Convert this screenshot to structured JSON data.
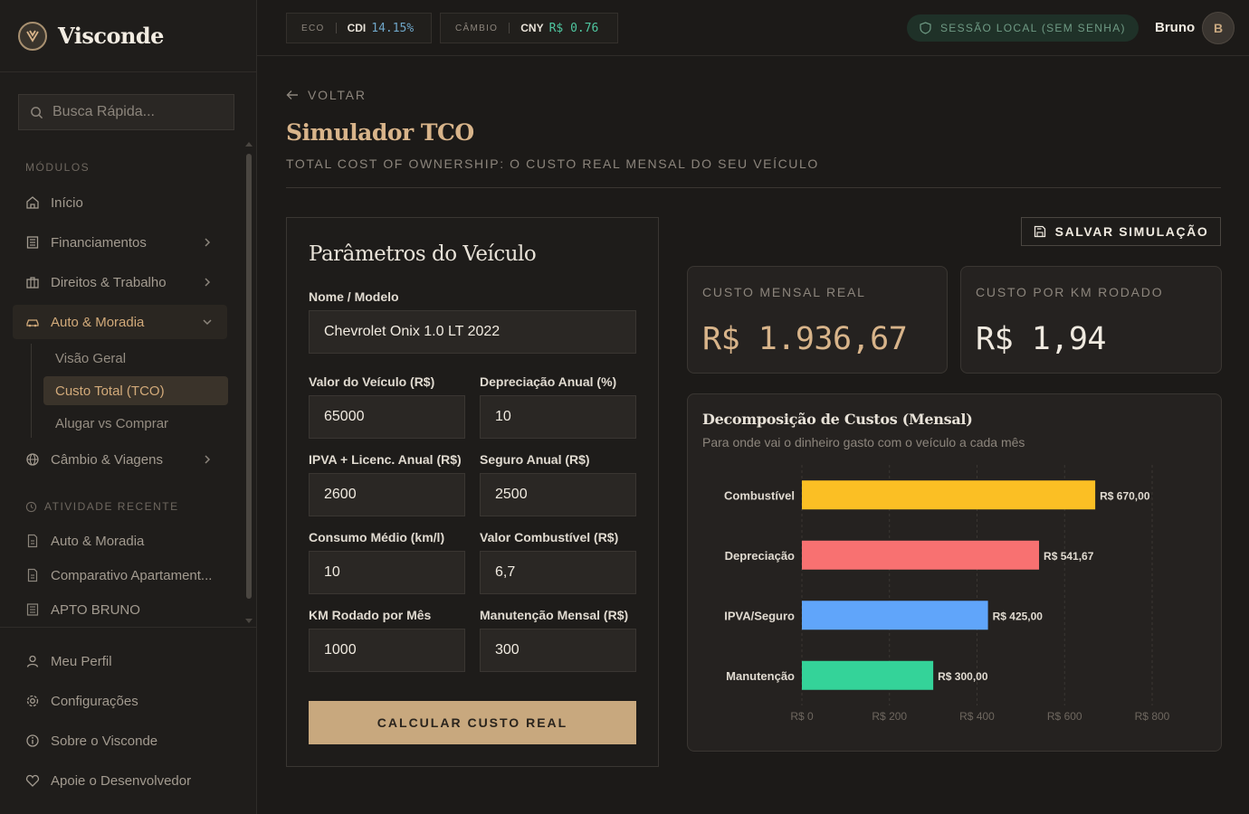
{
  "app": {
    "name": "Visconde"
  },
  "search": {
    "placeholder": "Busca Rápida..."
  },
  "sidebar": {
    "modules_label": "MÓDULOS",
    "items": [
      {
        "label": "Início",
        "icon": "home-icon"
      },
      {
        "label": "Financiamentos",
        "icon": "building-icon"
      },
      {
        "label": "Direitos & Trabalho",
        "icon": "briefcase-icon"
      },
      {
        "label": "Auto & Moradia",
        "icon": "car-icon"
      },
      {
        "label": "Câmbio & Viagens",
        "icon": "globe-icon"
      }
    ],
    "sub_items": [
      {
        "label": "Visão Geral"
      },
      {
        "label": "Custo Total (TCO)"
      },
      {
        "label": "Alugar vs Comprar"
      }
    ],
    "recent_label": "ATIVIDADE RECENTE",
    "recent": [
      {
        "label": "Auto & Moradia"
      },
      {
        "label": "Comparativo Apartament..."
      },
      {
        "label": "APTO BRUNO"
      }
    ],
    "footer": [
      {
        "label": "Meu Perfil",
        "icon": "user-icon"
      },
      {
        "label": "Configurações",
        "icon": "gear-icon"
      },
      {
        "label": "Sobre o Visconde",
        "icon": "info-icon"
      },
      {
        "label": "Apoie o Desenvolvedor",
        "icon": "heart-icon"
      }
    ]
  },
  "topbar": {
    "eco": {
      "label": "ECO",
      "code": "CDI",
      "value": "14.15%"
    },
    "fx": {
      "label": "CÂMBIO",
      "code": "CNY",
      "value": "R$ 0.76"
    },
    "session": "SESSÃO LOCAL (SEM SENHA)",
    "user": {
      "name": "Bruno",
      "initial": "B"
    }
  },
  "page": {
    "back": "VOLTAR",
    "title": "Simulador TCO",
    "subtitle": "TOTAL COST OF OWNERSHIP: O CUSTO REAL MENSAL DO SEU VEÍCULO",
    "save": "SALVAR SIMULAÇÃO"
  },
  "params": {
    "title": "Parâmetros do Veículo",
    "name_label": "Nome / Modelo",
    "name_value": "Chevrolet Onix 1.0 LT 2022",
    "fields": [
      {
        "label": "Valor do Veículo (R$)",
        "value": "65000"
      },
      {
        "label": "Depreciação Anual (%)",
        "value": "10"
      },
      {
        "label": "IPVA + Licenc. Anual (R$)",
        "value": "2600"
      },
      {
        "label": "Seguro Anual (R$)",
        "value": "2500"
      },
      {
        "label": "Consumo Médio (km/l)",
        "value": "10"
      },
      {
        "label": "Valor Combustível (R$)",
        "value": "6,7"
      },
      {
        "label": "KM Rodado por Mês",
        "value": "1000"
      },
      {
        "label": "Manutenção Mensal (R$)",
        "value": "300"
      }
    ],
    "calc_button": "CALCULAR CUSTO REAL"
  },
  "kpis": {
    "monthly": {
      "label": "CUSTO MENSAL REAL",
      "value": "R$ 1.936,67",
      "color": "#d8b48a"
    },
    "per_km": {
      "label": "CUSTO POR KM RODADO",
      "value": "R$ 1,94",
      "color": "#f0eae0"
    }
  },
  "chart": {
    "title": "Decomposição de Custos (Mensal)",
    "subtitle": "Para onde vai o dinheiro gasto com o veículo a cada mês"
  },
  "chart_data": {
    "type": "bar",
    "orientation": "horizontal",
    "categories": [
      "Combustível",
      "Depreciação",
      "IPVA/Seguro",
      "Manutenção"
    ],
    "values": [
      670,
      541.67,
      425,
      300
    ],
    "data_labels": [
      "R$ 670,00",
      "R$ 541,67",
      "R$ 425,00",
      "R$ 300,00"
    ],
    "colors": [
      "#fbbf24",
      "#f87171",
      "#60a5fa",
      "#34d399"
    ],
    "xlim": [
      0,
      800
    ],
    "xticks": [
      0,
      200,
      400,
      600,
      800
    ],
    "xtick_labels": [
      "R$ 0",
      "R$ 200",
      "R$ 400",
      "R$ 600",
      "R$ 800"
    ],
    "grid": true
  }
}
